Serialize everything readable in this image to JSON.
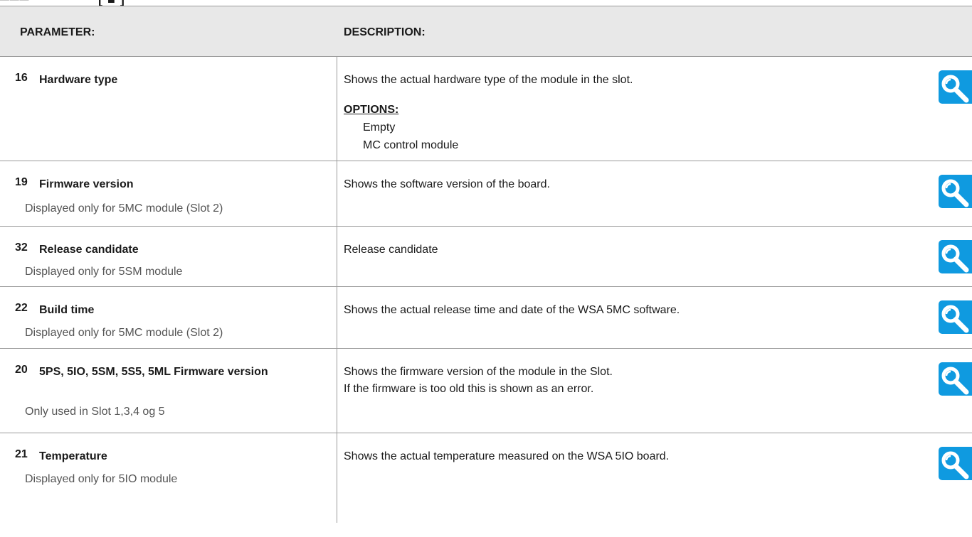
{
  "header": {
    "parameter": "PARAMETER:",
    "description": "DESCRIPTION:"
  },
  "rows": [
    {
      "number": "16",
      "name": "Hardware type",
      "note": "",
      "description": [
        "Shows the actual hardware type of the module in the slot."
      ],
      "options_label": "OPTIONS:",
      "options": [
        "Empty",
        "MC control module"
      ],
      "icon": "magnifier-icon"
    },
    {
      "number": "19",
      "name": "Firmware version",
      "note": "Displayed only for 5MC module (Slot 2)",
      "description": [
        "Shows the software version of the board."
      ],
      "icon": "magnifier-icon"
    },
    {
      "number": "32",
      "name": "Release candidate",
      "note": "Displayed only for 5SM module",
      "description": [
        "Release candidate"
      ],
      "icon": "magnifier-icon"
    },
    {
      "number": "22",
      "name": "Build time",
      "note": "Displayed only for 5MC module (Slot 2)",
      "description": [
        "Shows the actual release time and date of the WSA 5MC software."
      ],
      "icon": "magnifier-icon"
    },
    {
      "number": "20",
      "name": "5PS, 5IO, 5SM, 5S5, 5ML Firmware version",
      "note": "Only used in Slot 1,3,4 og 5",
      "description": [
        "Shows the firmware version of the module in the Slot.",
        "If the firmware is too old this is shown as an error."
      ],
      "icon": "magnifier-icon"
    },
    {
      "number": "21",
      "name": "Temperature",
      "note": "Displayed only for 5IO module",
      "description": [
        "Shows the actual temperature measured on the WSA 5IO board."
      ],
      "icon": "magnifier-icon"
    }
  ],
  "accent_color": "#0f9ae0"
}
